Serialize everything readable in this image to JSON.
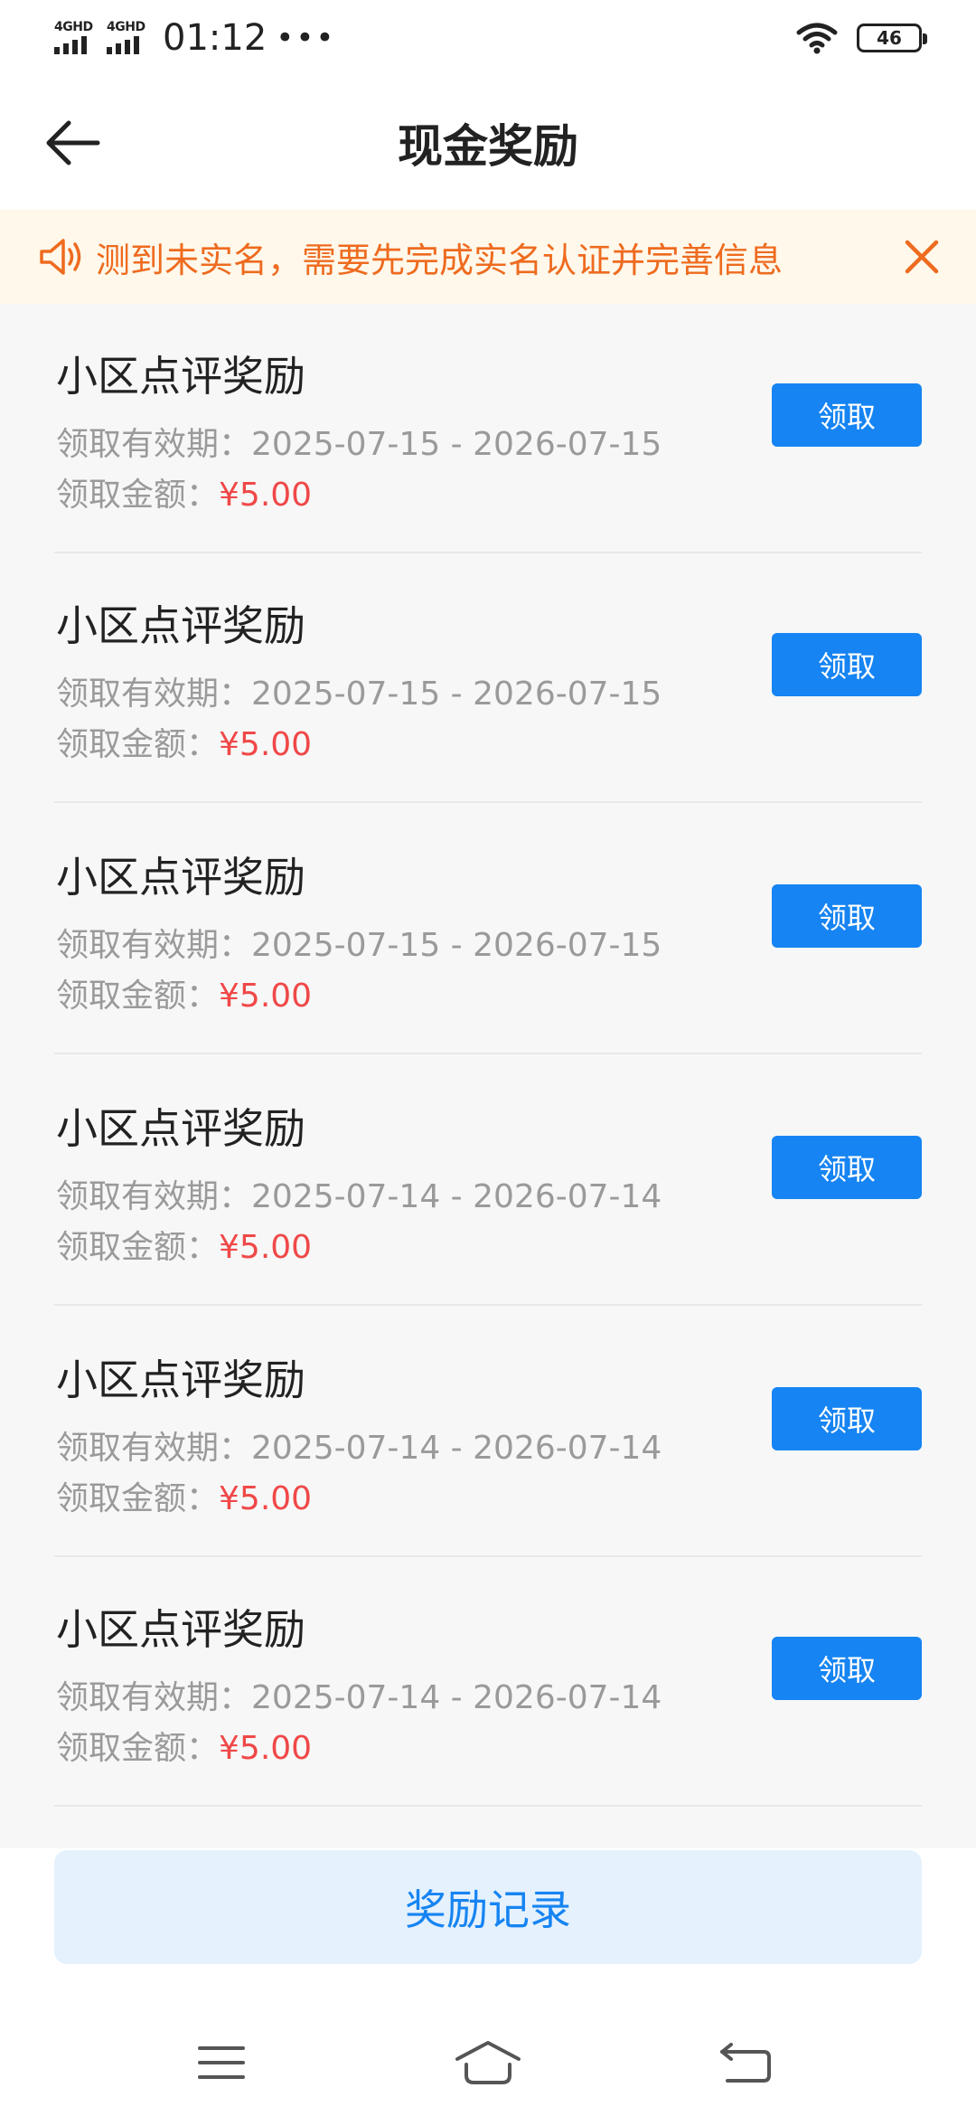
{
  "status_bar": {
    "network_1": "4GHD",
    "network_2": "4GHD",
    "time": "01:12",
    "overflow": "•••",
    "battery": "46"
  },
  "nav": {
    "title": "现金奖励"
  },
  "notice": {
    "text": "测到未实名，需要先完成实名认证并完善信息"
  },
  "rewards": [
    {
      "title": "小区点评奖励",
      "period_label": "领取有效期：",
      "period": "2025-07-15 - 2026-07-15",
      "amount_label": "领取金额：",
      "amount": "¥5.00",
      "button": "领取"
    },
    {
      "title": "小区点评奖励",
      "period_label": "领取有效期：",
      "period": "2025-07-15 - 2026-07-15",
      "amount_label": "领取金额：",
      "amount": "¥5.00",
      "button": "领取"
    },
    {
      "title": "小区点评奖励",
      "period_label": "领取有效期：",
      "period": "2025-07-15 - 2026-07-15",
      "amount_label": "领取金额：",
      "amount": "¥5.00",
      "button": "领取"
    },
    {
      "title": "小区点评奖励",
      "period_label": "领取有效期：",
      "period": "2025-07-14 - 2026-07-14",
      "amount_label": "领取金额：",
      "amount": "¥5.00",
      "button": "领取"
    },
    {
      "title": "小区点评奖励",
      "period_label": "领取有效期：",
      "period": "2025-07-14 - 2026-07-14",
      "amount_label": "领取金额：",
      "amount": "¥5.00",
      "button": "领取"
    },
    {
      "title": "小区点评奖励",
      "period_label": "领取有效期：",
      "period": "2025-07-14 - 2026-07-14",
      "amount_label": "领取金额：",
      "amount": "¥5.00",
      "button": "领取"
    }
  ],
  "footer": {
    "record_button": "奖励记录"
  },
  "colors": {
    "accent": "#1684f2",
    "notice_text": "#ee6b1f",
    "amount": "#f04848"
  },
  "icons": {
    "back": "arrow-left-icon",
    "speaker": "speaker-icon",
    "close": "close-icon",
    "wifi": "wifi-icon",
    "menu": "menu-icon",
    "home": "home-icon",
    "back_nav": "return-icon"
  }
}
